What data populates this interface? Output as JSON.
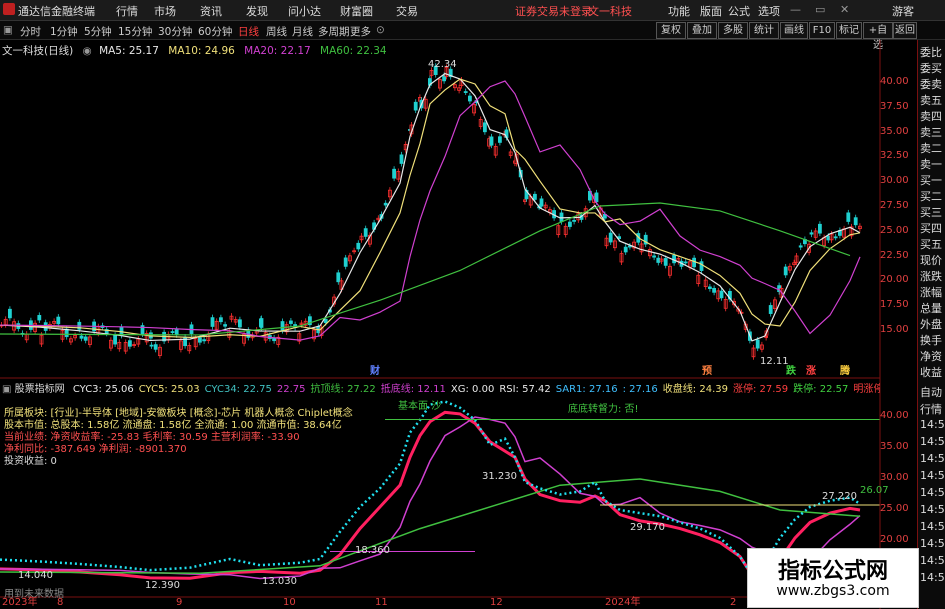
{
  "titlebar": {
    "app_name": "通达信金融终端",
    "menu": [
      "行情",
      "市场",
      "资讯",
      "发现",
      "问小达",
      "财富圈",
      "交易"
    ],
    "notice": "证券交易未登录",
    "stock_tab": "文一科技",
    "right_menu": [
      "功能",
      "版面",
      "公式",
      "选项"
    ],
    "guest": "游客"
  },
  "periodbar": {
    "periods": [
      "分时",
      "1分钟",
      "5分钟",
      "15分钟",
      "30分钟",
      "60分钟",
      "日线",
      "周线",
      "月线",
      "多周期",
      "更多"
    ],
    "active": "日线",
    "buttons": [
      "复权",
      "叠加",
      "多股",
      "统计",
      "画线",
      "F10",
      "标记",
      "+自选",
      "返回"
    ]
  },
  "main_chart": {
    "title": "文一科技(日线)",
    "ma": [
      {
        "label": "MA5: 25.17",
        "color": "#e8e8e8"
      },
      {
        "label": "MA10: 24.96",
        "color": "#f0e07a"
      },
      {
        "label": "MA20: 22.17",
        "color": "#d040d0"
      },
      {
        "label": "MA60: 22.34",
        "color": "#40c040"
      }
    ],
    "y_ticks": [
      "40.00",
      "37.50",
      "35.00",
      "32.50",
      "30.00",
      "27.50",
      "25.00",
      "22.50",
      "20.00",
      "17.50",
      "15.00"
    ],
    "high_label": "42.34",
    "low_label": "12.11",
    "markers": [
      {
        "text": "财",
        "color": "#6080ff"
      },
      {
        "text": "预",
        "color": "#ff8040"
      },
      {
        "text": "跌",
        "color": "#40d040"
      },
      {
        "text": "涨",
        "color": "#ff4040"
      },
      {
        "text": "腾",
        "color": "#ffd040"
      }
    ]
  },
  "indicator": {
    "name": "股票指标网",
    "values": [
      {
        "label": "CYC3: 25.06",
        "color": "#e8e8e8"
      },
      {
        "label": "CYC5: 25.03",
        "color": "#f0e07a"
      },
      {
        "label": "CYC34: 22.75",
        "color": "#40c0c0"
      },
      {
        "label": "22.75",
        "color": "#d040d0"
      },
      {
        "label": "抗顶线: 27.22",
        "color": "#40c040"
      },
      {
        "label": "抵底线: 12.11",
        "color": "#d040d0"
      },
      {
        "label": "XG: 0.00",
        "color": "#e8e8e8"
      },
      {
        "label": "RSI: 57.42",
        "color": "#e8e8e8"
      },
      {
        "label": "SAR1: 27.16",
        "color": "#40c0ff"
      },
      {
        "label": ": 27.16",
        "color": "#40c0ff"
      },
      {
        "label": "收盘线: 24.39",
        "color": "#f0e07a"
      },
      {
        "label": "涨停: 27.59",
        "color": "#ff4040"
      },
      {
        "label": "跌停: 22.57",
        "color": "#40d040"
      },
      {
        "label": "明涨停: 26.83",
        "color": "#ff4040"
      },
      {
        "label": "明跌停: 2",
        "color": "#40d040"
      }
    ],
    "info_lines": [
      "所属板块: [行业]-半导体 [地域]-安徽板块 [概念]-芯片 机器人概念 Chiplet概念",
      "股本市值: 总股本: 1.58亿 流通盘: 1.58亿 全流通: 1.00 流通市值: 38.64亿",
      "当前业绩: 净资收益率: -25.83 毛利率: 30.59 主营利润率: -33.90",
      "净利同比: -387.649    净利润: -8901.370",
      "投资收益: 0"
    ],
    "annotations": [
      "基本面  沙",
      "底底转督力: 否!",
      "31.230",
      "18.360",
      "14.040",
      "12.390",
      "13.030",
      "29.170",
      "27.220",
      "26.07",
      "用到未来数据"
    ],
    "y_ticks": [
      "40.00",
      "35.00",
      "30.00",
      "25.00",
      "20.00"
    ]
  },
  "x_axis": [
    "2023年",
    "8",
    "9",
    "10",
    "11",
    "12",
    "2024年",
    "2"
  ],
  "right_panel": {
    "top_items": [
      "委比",
      "委买",
      "委卖",
      "卖五",
      "卖四",
      "卖三",
      "卖二",
      "卖一",
      "买一",
      "买二",
      "买三",
      "买四",
      "买五",
      "现价",
      "涨跌",
      "涨幅",
      "总量",
      "外盘",
      "换手",
      "净资",
      "收益"
    ],
    "bottom_items": [
      "自动",
      "行情",
      "14:5",
      "14:5",
      "14:5",
      "14:5",
      "14:5",
      "14:5",
      "14:5",
      "14:5",
      "14:5",
      "14:5"
    ]
  },
  "watermark": {
    "title": "指标公式网",
    "url": "www.zbgs3.com"
  }
}
